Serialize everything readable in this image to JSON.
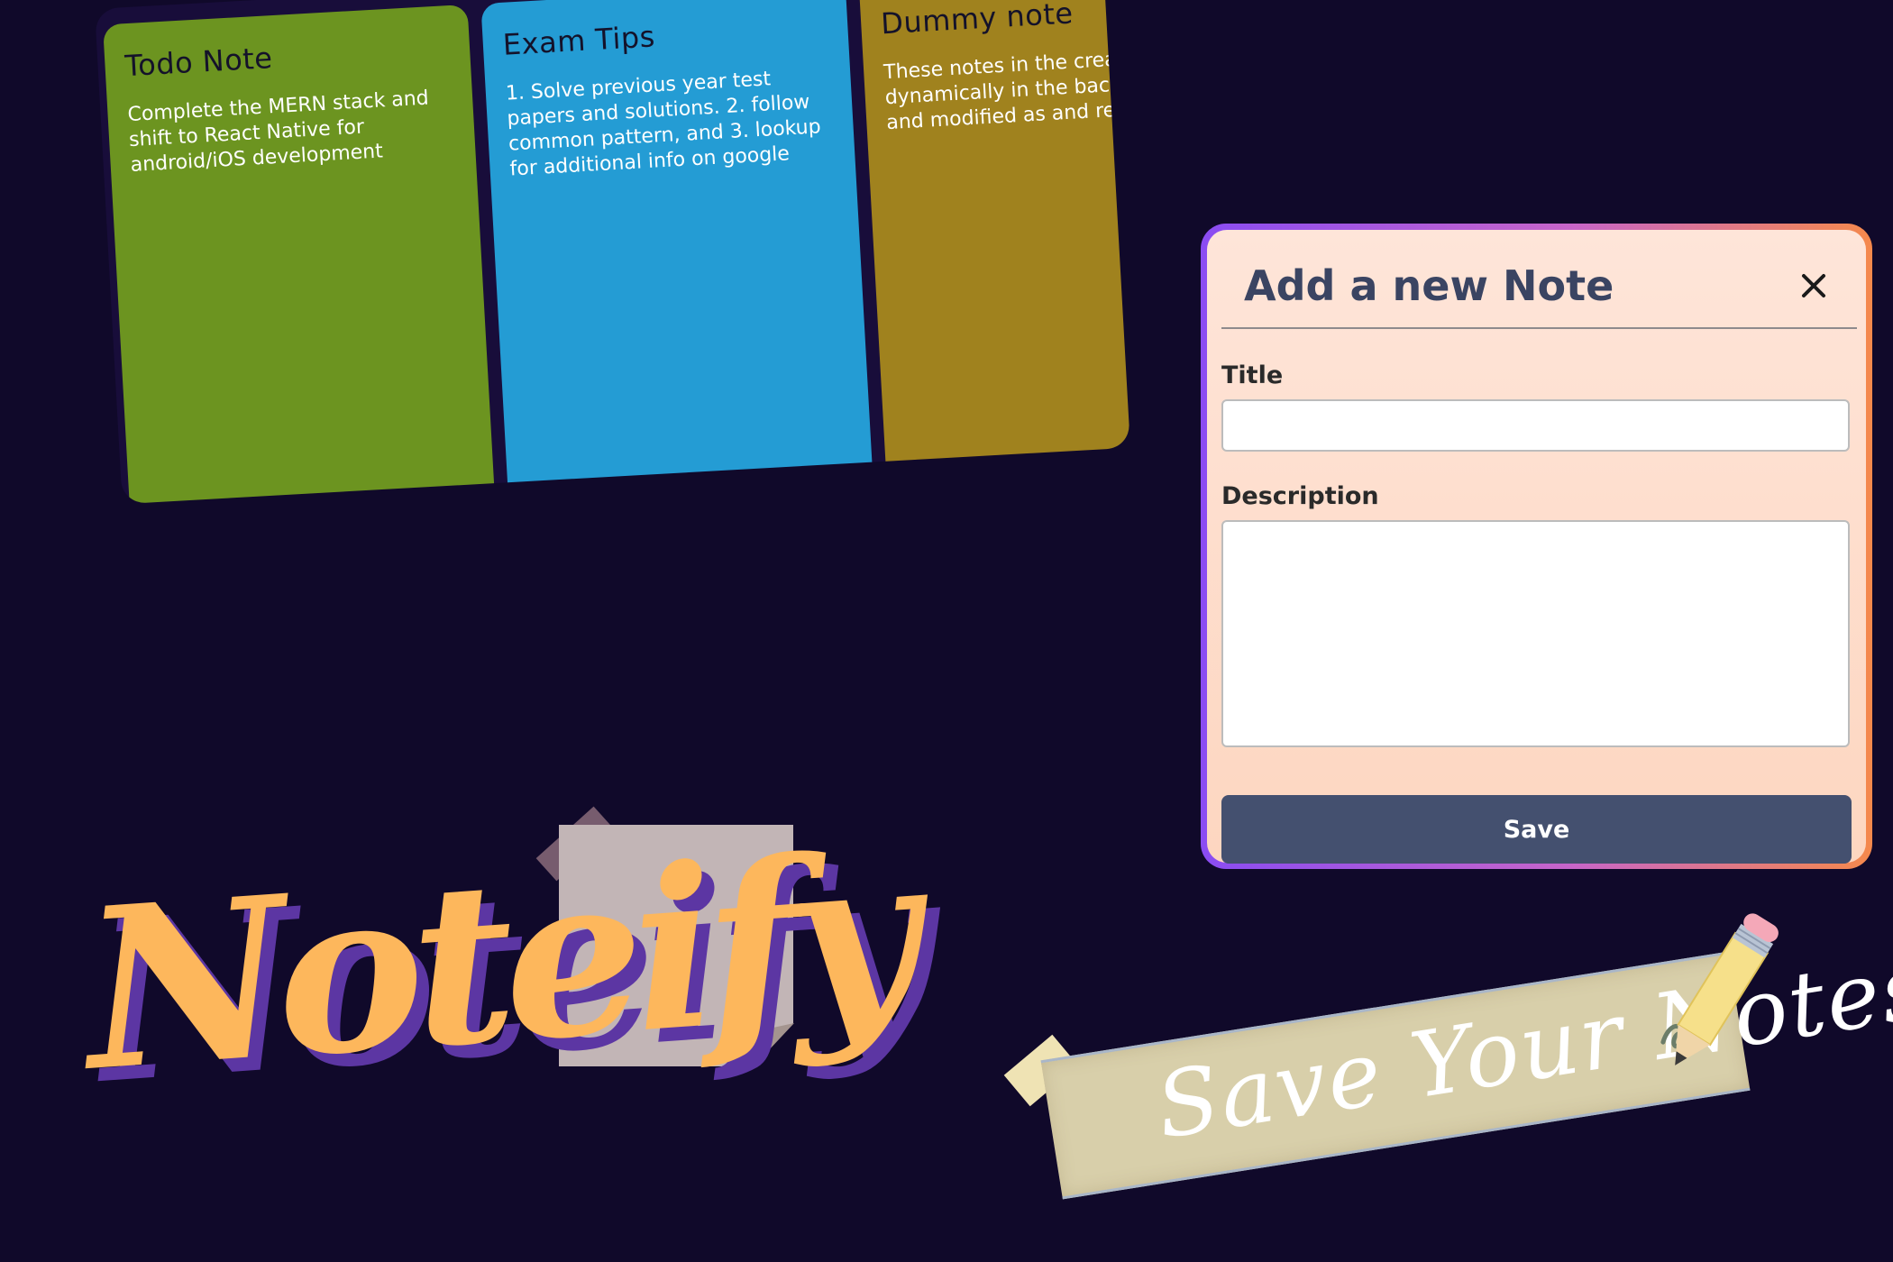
{
  "notes": [
    {
      "title": "Todo Note",
      "description": "Complete the MERN stack and shift to React Native for android/iOS development",
      "color": "#6c9420"
    },
    {
      "title": "Exam Tips",
      "description": "1. Solve previous year test papers and solutions. 2. follow common pattern, and 3. lookup for additional info on google",
      "color": "#249cd4"
    },
    {
      "title": "Dummy note",
      "description": "These notes in the created dynamically in the backend too and modified as and required!",
      "color": "#a0821e"
    }
  ],
  "modal": {
    "title": "Add a new Note",
    "close_icon": "close-icon",
    "title_label": "Title",
    "title_value": "",
    "description_label": "Description",
    "description_value": "",
    "save_label": "Save",
    "colors": {
      "border_start": "#8a4cf2",
      "border_end": "#f5894c",
      "background": "#fee5d9",
      "button": "#44506f",
      "heading": "#3a4462"
    }
  },
  "branding": {
    "logo_text": "Noteify",
    "banner_text": "Save Your Notes",
    "logo_color": "#fdb75c",
    "logo_shadow_color": "#5c36a3"
  },
  "page": {
    "background": "#10092a"
  }
}
